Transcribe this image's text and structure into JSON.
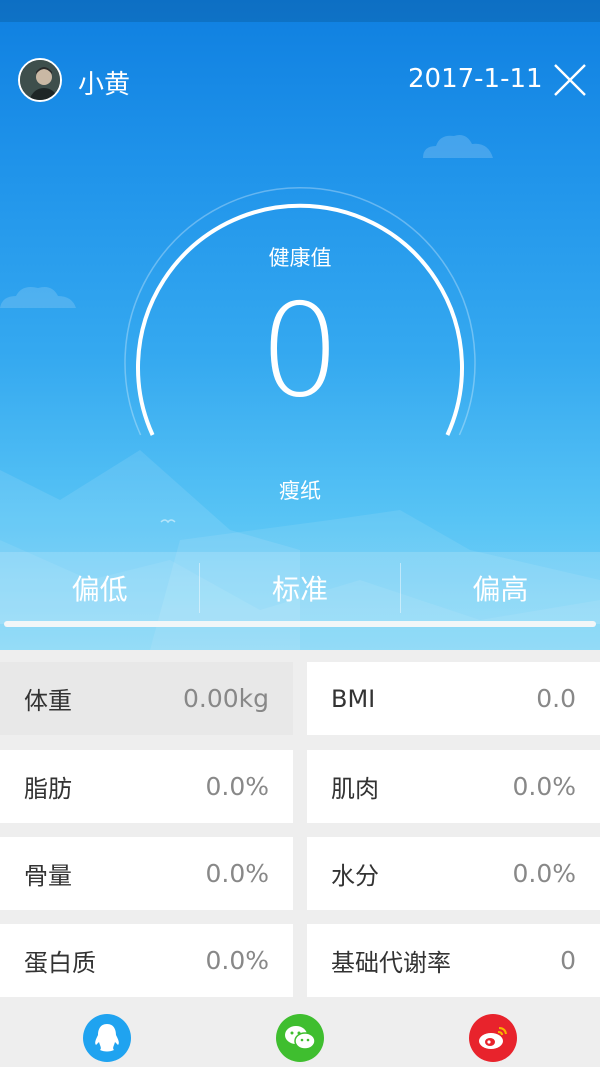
{
  "header": {
    "username": "小黄",
    "date": "2017-1-11"
  },
  "gauge": {
    "label": "健康值",
    "value": "0",
    "status": "瘦纸",
    "fraction": 0
  },
  "scale": {
    "items": [
      {
        "label": "偏低"
      },
      {
        "label": "标准"
      },
      {
        "label": "偏高"
      }
    ]
  },
  "metrics": [
    {
      "label": "体重",
      "value": "0.00kg",
      "selected": true
    },
    {
      "label": "BMI",
      "value": "0.0"
    },
    {
      "label": "脂肪",
      "value": "0.0%"
    },
    {
      "label": "肌肉",
      "value": "0.0%"
    },
    {
      "label": "骨量",
      "value": "0.0%"
    },
    {
      "label": "水分",
      "value": "0.0%"
    },
    {
      "label": "蛋白质",
      "value": "0.0%"
    },
    {
      "label": "基础代谢率",
      "value": "0"
    }
  ],
  "share": [
    {
      "icon": "qq-icon",
      "color": "#1fa3f0"
    },
    {
      "icon": "wechat-icon",
      "color": "#3fbe2f"
    },
    {
      "icon": "weibo-icon",
      "color": "#e8232c"
    }
  ]
}
